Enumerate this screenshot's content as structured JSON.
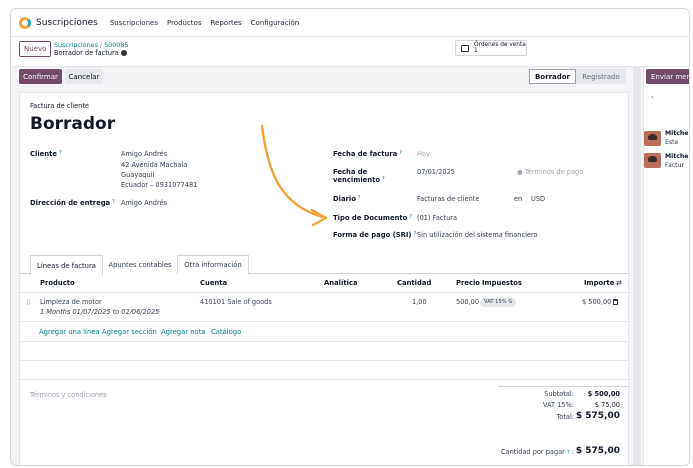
{
  "topnav": {
    "app_name": "Suscripciones",
    "menu": [
      "Suscripciones",
      "Productos",
      "Reportes",
      "Configuración"
    ]
  },
  "control": {
    "new_label": "Nuevo",
    "breadcrumb_parent": "Suscripciones",
    "breadcrumb_sep": "/",
    "breadcrumb_current": "S00085",
    "record_title": "Borrador de factura",
    "smart_button_line1": "Órdenes de venta",
    "smart_button_line2": "1"
  },
  "actions": {
    "confirm_label": "Confirmar",
    "cancel_label": "Cancelar",
    "status_steps": [
      "Borrador",
      "Registrado"
    ],
    "status_active": "Borrador"
  },
  "form": {
    "doc_type": "Factura de cliente",
    "title": "Borrador",
    "customer_label": "Cliente",
    "customer_name": "Amigo Andrés",
    "customer_address": [
      "42 Avenida Machala",
      "Guayaquil",
      "Ecuador – 0931077481"
    ],
    "delivery_label": "Dirección de entrega",
    "delivery_value": "Amigo Andrés",
    "invoice_date_label": "Fecha de factura",
    "invoice_date_placeholder": "Hoy",
    "due_date_label_1": "Fecha de",
    "due_date_label_2": "vencimiento",
    "due_date_value": "07/01/2025",
    "payment_terms_placeholder": "Términos de pago",
    "journal_label": "Diario",
    "journal_value": "Facturas de cliente",
    "journal_in": "en",
    "currency": "USD",
    "doc_type_label": "Tipo de Documento",
    "doc_type_value": "(01) Factura",
    "payment_form_label": "Forma de pago (SRI)",
    "payment_form_value": "Sin utilización del sistema financiero"
  },
  "tabs": [
    "Líneas de factura",
    "Apuntes contables",
    "Otra información"
  ],
  "lines": {
    "headers": {
      "product": "Producto",
      "account": "Cuenta",
      "analytic": "Analítica",
      "quantity": "Cantidad",
      "price": "Precio",
      "taxes": "Impuestos",
      "amount": "Importe"
    },
    "rows": [
      {
        "product": "Limpieza de motor",
        "description": "1 Months 01/07/2025 to 02/06/2025",
        "account": "410101 Sale of goods",
        "quantity": "1,00",
        "price": "500,00",
        "tax": "VAT 15% G",
        "amount": "$ 500,00"
      }
    ],
    "add_links": [
      "Agregar una línea",
      "Agregar sección",
      "Agregar nota",
      "Catálogo"
    ]
  },
  "footer": {
    "terms_placeholder": "Términos y condiciones",
    "subtotal_label": "Subtotal:",
    "subtotal_value": "$ 500,00",
    "vat_label": "VAT 15%:",
    "vat_value": "$ 75,00",
    "total_label": "Total:",
    "total_value": "$ 575,00",
    "amount_due_label": "Cantidad por pagar",
    "amount_due_value": "$ 575,00"
  },
  "chatter": {
    "send_label": "Enviar men",
    "messages": [
      {
        "author": "Mitche",
        "text": "Este"
      },
      {
        "author": "Mitche",
        "text": "Factur"
      }
    ]
  },
  "colors": {
    "primary": "#714b67",
    "link": "#017e84",
    "arrow": "#f6a23a"
  }
}
